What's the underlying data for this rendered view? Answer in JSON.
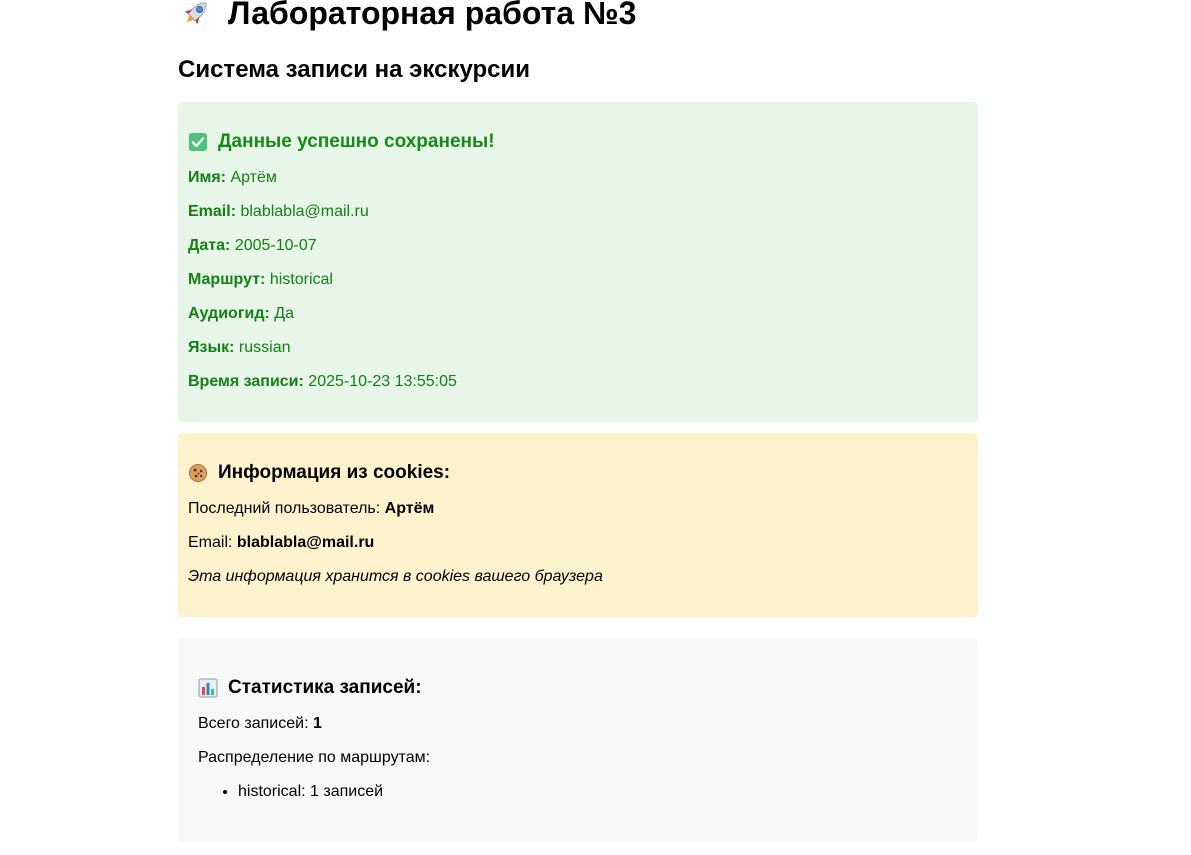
{
  "header": {
    "icon": "rocket-icon",
    "title": "Лабораторная работа №3",
    "subtitle": "Система записи на экскурсии"
  },
  "success": {
    "icon": "check-box-icon",
    "title": "Данные успешно сохранены!",
    "accent_color": "#168a16",
    "background": "#e8f5e9",
    "fields": [
      {
        "label": "Имя:",
        "value": "Артём"
      },
      {
        "label": "Email:",
        "value": "blablabla@mail.ru"
      },
      {
        "label": "Дата:",
        "value": "2005-10-07"
      },
      {
        "label": "Маршрут:",
        "value": "historical"
      },
      {
        "label": "Аудиогид:",
        "value": "Да"
      },
      {
        "label": "Язык:",
        "value": "russian"
      },
      {
        "label": "Время записи:",
        "value": "2025-10-23 13:55:05"
      }
    ]
  },
  "cookies": {
    "icon": "cookie-icon",
    "title": "Информация из cookies:",
    "background": "#fff3cd",
    "last_user_label": "Последний пользователь:",
    "last_user_value": "Артём",
    "email_label": "Email:",
    "email_value": "blablabla@mail.ru",
    "note": "Эта информация хранится в cookies вашего браузера"
  },
  "stats": {
    "icon": "bar-chart-icon",
    "title": "Статистика записей:",
    "background": "#f8f8f8",
    "total_label": "Всего записей:",
    "total_value": "1",
    "distribution_label": "Распределение по маршрутам:",
    "routes": [
      {
        "text": "historical: 1 записей"
      }
    ]
  }
}
